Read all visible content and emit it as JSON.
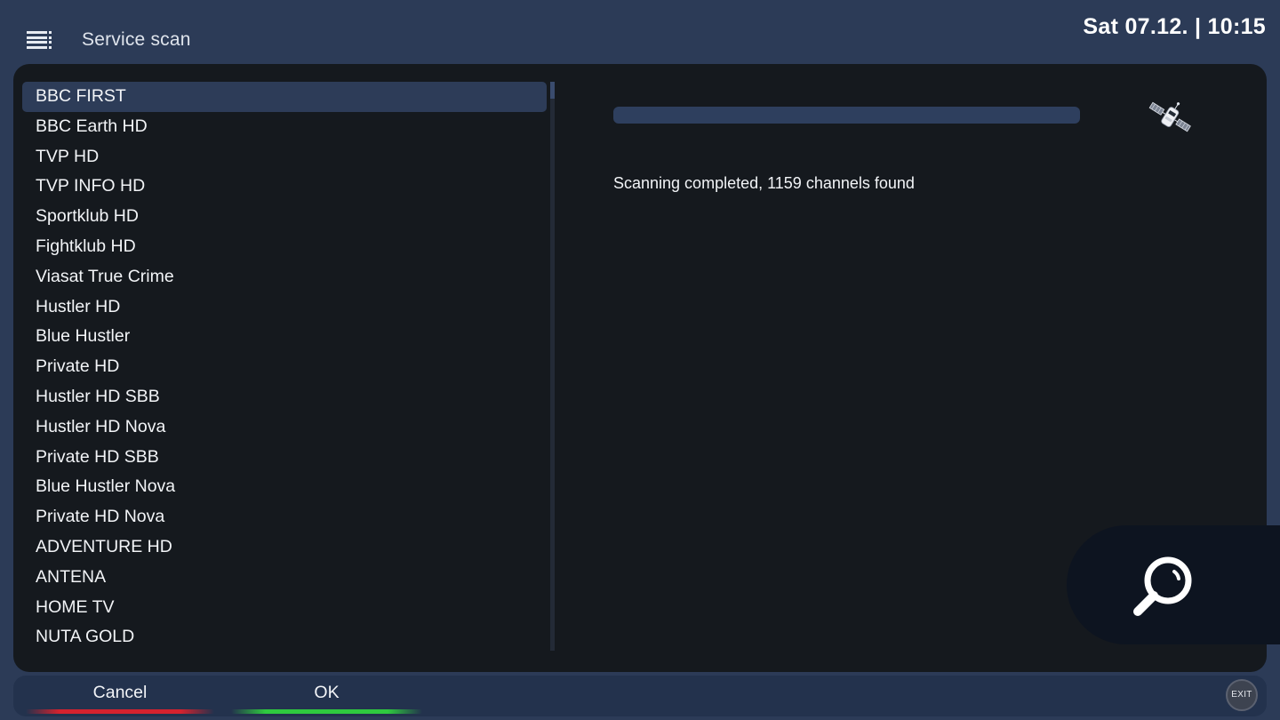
{
  "header": {
    "title": "Service scan",
    "datetime": "Sat 07.12. | 10:15"
  },
  "channels": [
    "BBC FIRST",
    "BBC Earth HD",
    "TVP HD",
    "TVP INFO HD",
    "Sportklub HD",
    "Fightklub HD",
    "Viasat True Crime",
    "Hustler HD",
    "Blue Hustler",
    "Private HD",
    "Hustler HD SBB",
    "Hustler HD Nova",
    "Private HD SBB",
    "Blue Hustler Nova",
    "Private HD Nova",
    "ADVENTURE HD",
    "ANTENA",
    "HOME TV",
    "NUTA GOLD"
  ],
  "selected_index": 0,
  "scan": {
    "status": "Scanning completed, 1159 channels found",
    "progress": 1.0
  },
  "footer": {
    "cancel_label": "Cancel",
    "ok_label": "OK",
    "exit_label": "EXIT"
  },
  "colors": {
    "background": "#2c3b57",
    "panel": "#15191e",
    "selection": "#2d3c58",
    "red_key": "#d6222e",
    "green_key": "#2fc93f"
  },
  "icons": {
    "menu": "menu-icon",
    "satellite": "satellite-icon",
    "search": "search-icon"
  }
}
